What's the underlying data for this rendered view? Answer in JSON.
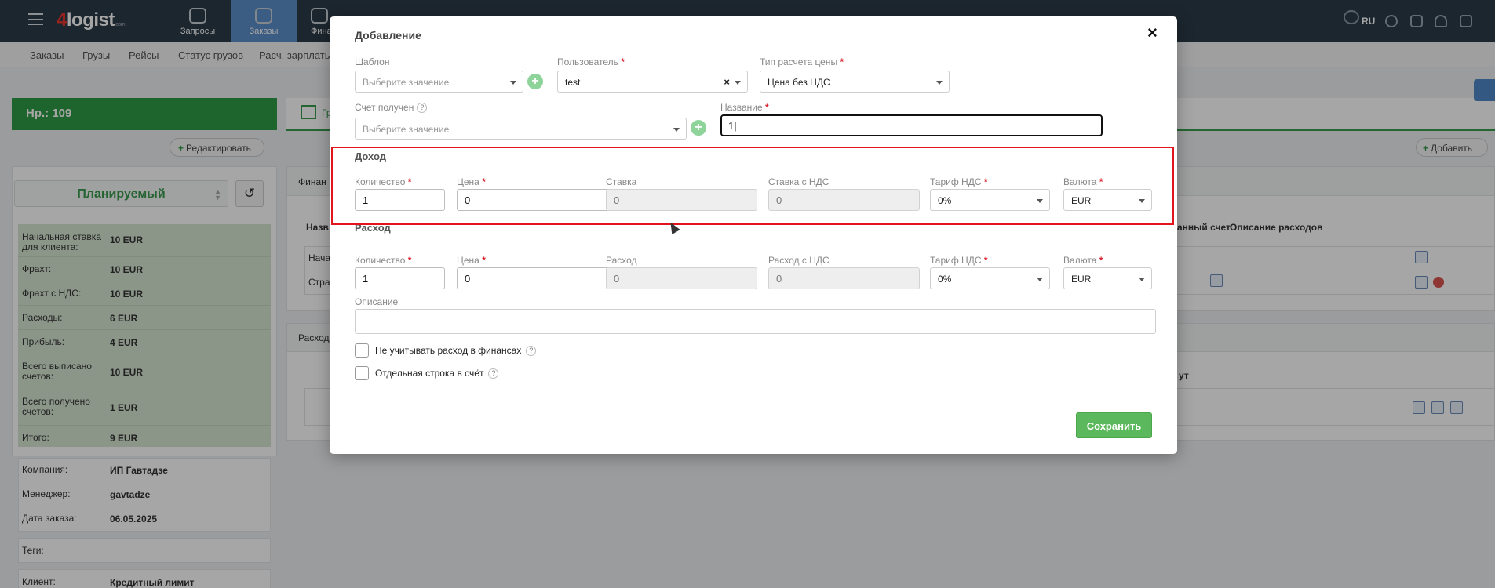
{
  "topbar": {
    "logo_num": "4",
    "logo_text": "logist",
    "logo_suffix": ".com",
    "nav": [
      {
        "label": "Запросы",
        "icon": "requests-icon"
      },
      {
        "label": "Заказы",
        "icon": "orders-icon",
        "active": true
      },
      {
        "label": "Фина",
        "icon": "finance-icon"
      }
    ],
    "lang": "RU"
  },
  "subnav": [
    "Заказы",
    "Грузы",
    "Рейсы",
    "Статус грузов",
    "Расч. зарплаты"
  ],
  "left": {
    "order_number": "Нр.: 109",
    "edit_button": "Редактировать",
    "status": "Планируемый",
    "finance_rows": [
      {
        "label": "Начальная ставка для клиента:",
        "value": "10 EUR"
      },
      {
        "label": "Фрахт:",
        "value": "10 EUR"
      },
      {
        "label": "Фрахт с НДС:",
        "value": "10 EUR"
      },
      {
        "label": "Расходы:",
        "value": "6 EUR"
      },
      {
        "label": "Прибыль:",
        "value": "4 EUR"
      },
      {
        "label": "Всего выписано счетов:",
        "value": "10 EUR"
      },
      {
        "label": "Всего получено счетов:",
        "value": "1 EUR"
      },
      {
        "label": "Итого:",
        "value": "9 EUR"
      }
    ],
    "info_rows": [
      {
        "label": "Компания:",
        "value": "ИП Гавтадзе"
      },
      {
        "label": "Менеджер:",
        "value": "gavtadze"
      },
      {
        "label": "Дата заказа:",
        "value": "06.05.2025"
      }
    ],
    "tags_label": "Теги:",
    "client_label": "Клиент:",
    "client_value": "Кредитный лимит"
  },
  "main": {
    "tab_partial": "Гр",
    "add_button": "Добавить",
    "finance_header_partial": "Финан",
    "col_name_partial": "Назв",
    "row1_partial": "Нача",
    "row2_partial": "Стра",
    "col_invoice_partial": "анный счет",
    "col_expense_desc": "Описание расходов",
    "expenses_header_partial": "Расход",
    "col_currency_partial": "ут"
  },
  "modal": {
    "title": "Добавление",
    "close": "×",
    "template": {
      "label": "Шаблон",
      "placeholder": "Выберите значение"
    },
    "user": {
      "label": "Пользователь",
      "value": "test"
    },
    "price_type": {
      "label": "Тип расчета цены",
      "value": "Цена без НДС"
    },
    "invoice_received": {
      "label": "Счет получен",
      "placeholder": "Выберите значение"
    },
    "name": {
      "label": "Название",
      "value": "1"
    },
    "income": {
      "title": "Доход",
      "quantity_label": "Количество",
      "quantity": "1",
      "price_label": "Цена",
      "price": "0",
      "rate_label": "Ставка",
      "rate": "0",
      "rate_vat_label": "Ставка с НДС",
      "rate_vat": "0",
      "vat_label": "Тариф НДС",
      "vat": "0%",
      "currency_label": "Валюта",
      "currency": "EUR"
    },
    "expense": {
      "title": "Расход",
      "quantity_label": "Количество",
      "quantity": "1",
      "price_label": "Цена",
      "price": "0",
      "expense_label": "Расход",
      "expense": "0",
      "expense_vat_label": "Расход с НДС",
      "expense_vat": "0",
      "vat_label": "Тариф НДС",
      "vat": "0%",
      "currency_label": "Валюта",
      "currency": "EUR"
    },
    "description_label": "Описание",
    "checkbox_exclude": "Не учитывать расход в финансах",
    "checkbox_separate": "Отдельная строка в счёт",
    "help": "?",
    "required": "*",
    "plus": "+",
    "save": "Сохранить"
  },
  "colors": {
    "accent_green": "#3a9b4d",
    "save_green": "#5cb85c",
    "highlight_red": "#e2141c",
    "topbar": "#2c3b47",
    "active_nav": "#5b8ec9"
  }
}
